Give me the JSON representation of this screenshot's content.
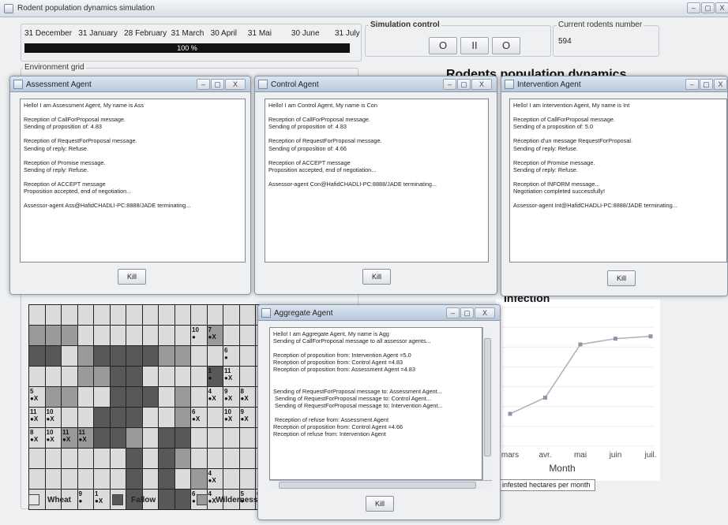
{
  "app": {
    "title": "Rodent population dynamics simulation",
    "win_buttons": [
      "–",
      "▢",
      "X"
    ]
  },
  "timeline": {
    "months": "31 December   31 January   28 February  31 March   30 April     31 Mai         30 June       31 July",
    "progress_text": "100 %",
    "progress": 1.0
  },
  "sim_control": {
    "label": "Simulation control",
    "buttons": [
      "O",
      "II",
      "O"
    ]
  },
  "rodents": {
    "label": "Current rodents number",
    "value": "594"
  },
  "environment": {
    "label": "Environment grid",
    "legend": [
      "Wheat",
      "Fallow",
      "Wilderness"
    ]
  },
  "background_chart": {
    "title": "Rodents population dynamics",
    "infection_title": "Infection",
    "x_ticks": [
      "mars",
      "avr.",
      "mai",
      "juin",
      "juil."
    ],
    "x_label": "Month",
    "legend_text": "f infested hectares per month"
  },
  "chart_data": {
    "type": "line",
    "title": "Infection",
    "xlabel": "Month",
    "ylabel": "",
    "x": [
      "mars",
      "avr.",
      "mai",
      "juin",
      "juil."
    ],
    "series": [
      {
        "name": "f infested hectares per month",
        "values": [
          0.28,
          0.42,
          0.88,
          0.93,
          0.95
        ]
      }
    ],
    "ylim": [
      0,
      1.2
    ],
    "grid": true
  },
  "grid_cells": {
    "colors": [
      [
        0,
        0,
        0,
        0,
        0,
        0,
        0,
        0,
        0,
        0,
        0,
        0,
        0,
        0,
        0
      ],
      [
        2,
        2,
        2,
        0,
        0,
        0,
        0,
        0,
        0,
        0,
        0,
        2,
        0,
        0,
        0
      ],
      [
        1,
        1,
        0,
        2,
        1,
        1,
        1,
        1,
        2,
        2,
        0,
        0,
        0,
        0,
        0
      ],
      [
        0,
        0,
        0,
        2,
        2,
        1,
        1,
        0,
        0,
        0,
        0,
        1,
        0,
        0,
        0
      ],
      [
        0,
        2,
        2,
        0,
        0,
        1,
        1,
        1,
        0,
        2,
        0,
        0,
        0,
        0,
        0
      ],
      [
        0,
        0,
        0,
        0,
        1,
        1,
        1,
        0,
        0,
        2,
        0,
        0,
        0,
        0,
        0
      ],
      [
        0,
        0,
        2,
        2,
        1,
        1,
        2,
        0,
        1,
        1,
        0,
        0,
        0,
        0,
        0
      ],
      [
        0,
        0,
        0,
        0,
        0,
        0,
        1,
        0,
        1,
        2,
        0,
        0,
        0,
        0,
        0
      ],
      [
        0,
        0,
        0,
        0,
        0,
        0,
        1,
        0,
        1,
        0,
        2,
        0,
        0,
        0,
        0
      ],
      [
        0,
        0,
        0,
        0,
        0,
        0,
        1,
        0,
        1,
        1,
        0,
        0,
        0,
        0,
        0
      ]
    ],
    "labels": {
      "1-10": [
        "10",
        "●"
      ],
      "1-11": [
        "7",
        "●X"
      ],
      "2-12": [
        "6",
        "●"
      ],
      "3-11": [
        "1",
        "●"
      ],
      "3-12": [
        "11",
        "●X"
      ],
      "4-0": [
        "5",
        "●X"
      ],
      "4-11": [
        "4",
        "●X"
      ],
      "4-12": [
        "9",
        "●X"
      ],
      "4-13": [
        "8",
        "●X"
      ],
      "5-0": [
        "11",
        "●X"
      ],
      "5-1": [
        "10",
        "●X"
      ],
      "5-10": [
        "6",
        "●X"
      ],
      "5-12": [
        "10",
        "●X"
      ],
      "5-13": [
        "9",
        "●X"
      ],
      "6-0": [
        "8",
        "●X"
      ],
      "6-1": [
        "10",
        "●X"
      ],
      "6-2": [
        "11",
        "●X"
      ],
      "6-3": [
        "11",
        "●X"
      ],
      "8-11": [
        "4",
        "●X"
      ],
      "9-3": [
        "9",
        "●"
      ],
      "9-4": [
        "1",
        "●X"
      ],
      "9-10": [
        "6",
        "●"
      ],
      "9-11": [
        "4",
        "●X"
      ],
      "9-13": [
        "5",
        "●"
      ],
      "9-14": [
        "6",
        "●"
      ]
    }
  },
  "agents": {
    "assessment": {
      "title": "Assessment Agent",
      "log": "Hello! I am Assessment Agent, My name is Ass\n\nReception of CallForProposal message.\nSending of proposition of: 4.83\n\nReception of RequestForProposal message.\nSending of reply: Refuse.\n\nReception of Promise message.\nSending of reply: Refuse.\n\nReception of ACCEPT message\nProposition accepted, end of negotiation...\n\nAssessor-agent Ass@HafidCHADLI-PC:8888/JADE terminating...",
      "kill": "Kill"
    },
    "control": {
      "title": "Control Agent",
      "log": "Hello! I am Control Agent, My name is Con\n\nReception of CallForProposal message.\nSending of proposition of: 4.83\n\nReception of RequestForProposal message.\nSending of proposition of: 4.66\n\nReception of ACCEPT message\nProposition accepted, end of negotiation...\n\nAssessor-agent Con@HafidCHADLI-PC:8888/JADE terminating...",
      "kill": "Kill"
    },
    "intervention": {
      "title": "Intervention Agent",
      "log": "Hello! I am Intervention Agent, My name is Int\n\nReception of CallForProposal message.\nSending of a proposition of: 5.0\n\nRéception d'un message RequestForProposal.\nSending of reply: Refuse.\n\nReception of Promise message.\nSending of reply: Refuse.\n\nReception of INFORM message...\nNegotiation completed successfully!\n\nAssessor-agent Int@HafidCHADLI-PC:8888/JADE terminating...",
      "kill": "Kill"
    },
    "aggregate": {
      "title": "Aggregate Agent",
      "log": "Hello! I am Aggregate Agent, My name is Agg\nSending of CallForProposal message to all assessor agents...\n\nReception of proposition from: Intervention Agent =5.0\nReception of proposition from: Control Agent =4.83\nReception of proposition from: Assessment Agent =4.83\n\n\nSending of RequestForProposal message to: Assessment Agent...\n Sending of RequestForProposal message to: Control Agent...\n Sending of RequestForProposal message to: Intervention Agent...\n\n Reception of refuse from: Assessment Agent\nReception of proposition from: Control Agent =4.66\nReception of refuse from: Intervention Agent",
      "kill": "Kill"
    }
  }
}
